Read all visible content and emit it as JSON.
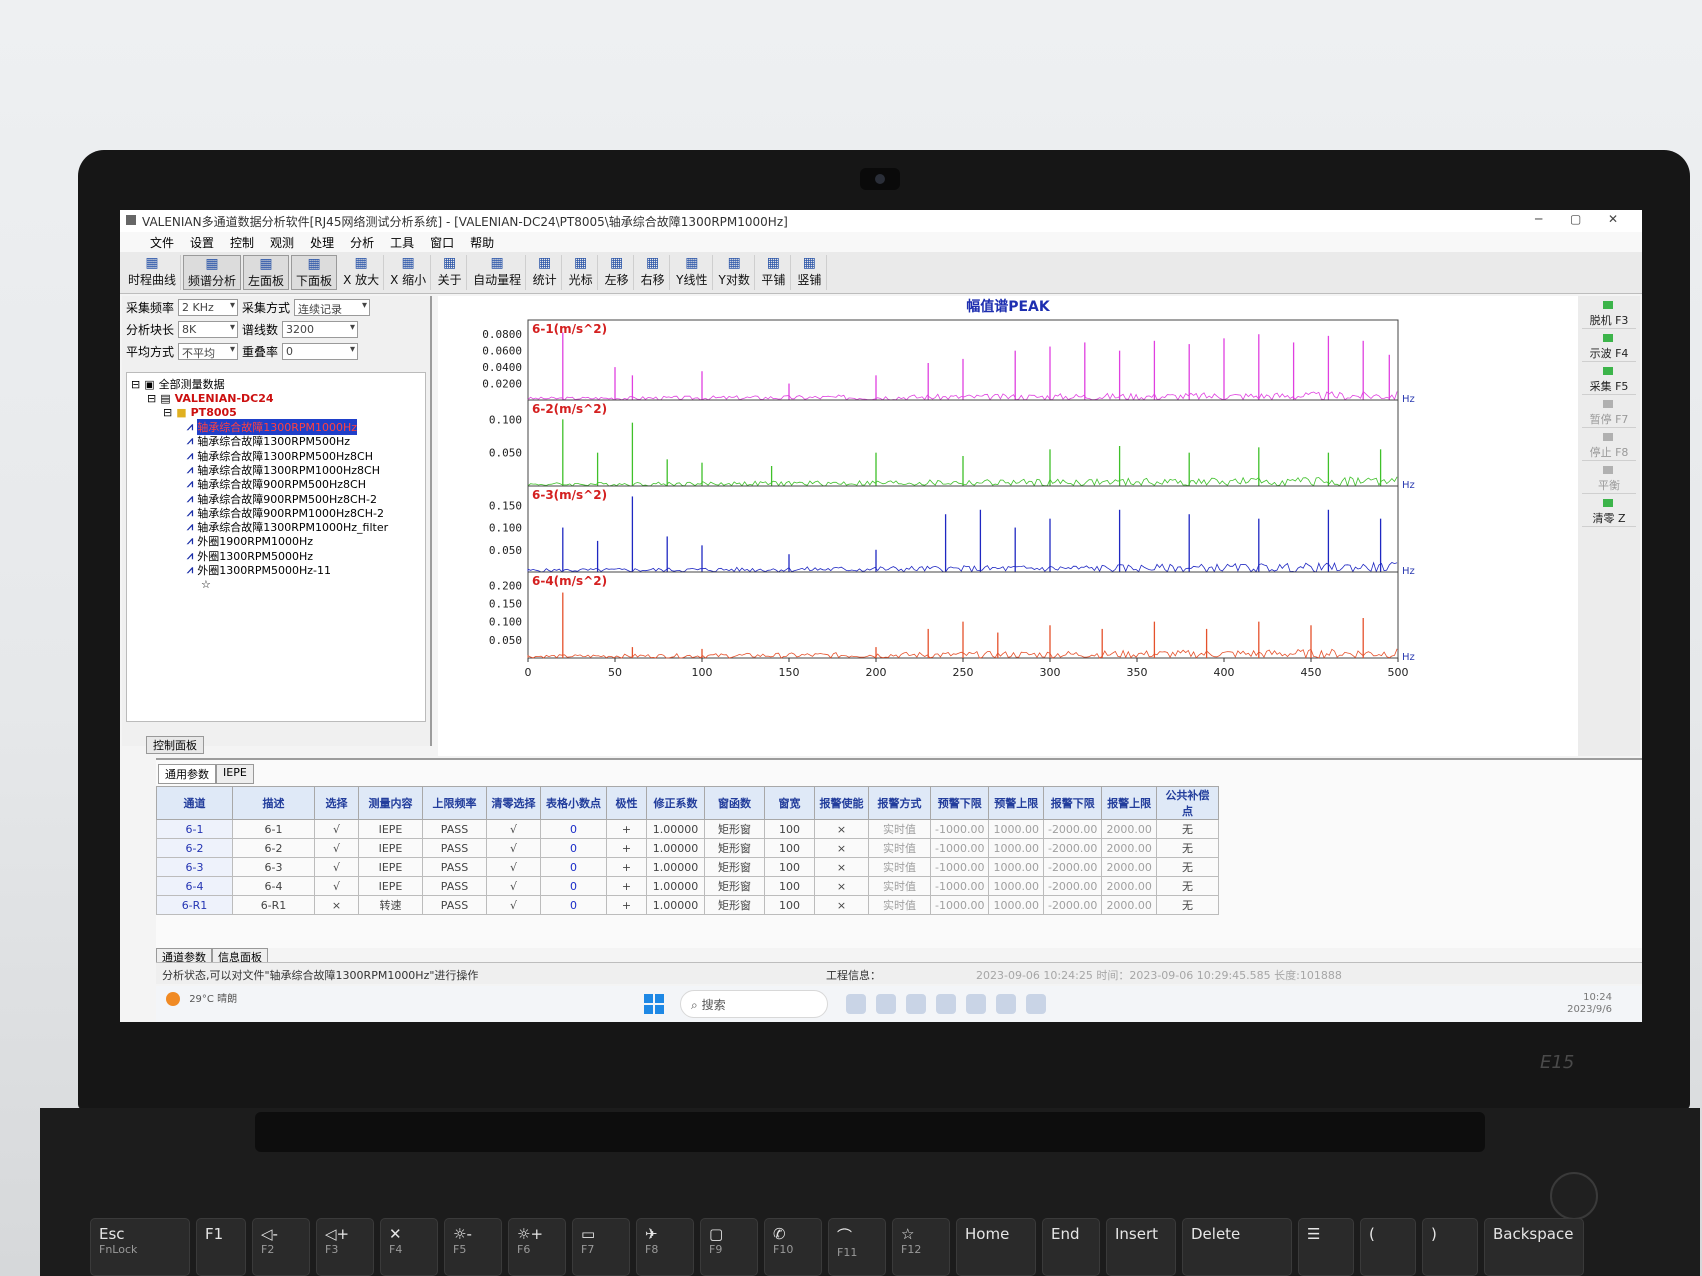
{
  "window": {
    "title": "VALENIAN多通道数据分析软件[RJ45网络测试分析系统] - [VALENIAN-DC24\\PT8005\\轴承综合故障1300RPM1000Hz]"
  },
  "menu": [
    "文件",
    "设置",
    "控制",
    "观测",
    "处理",
    "分析",
    "工具",
    "窗口",
    "帮助"
  ],
  "toolbar": [
    {
      "label": "时程曲线",
      "icon": "time-curve-icon"
    },
    {
      "label": "频谱分析",
      "icon": "spectrum-icon",
      "active": true
    },
    {
      "label": "左面板",
      "icon": "left-panel-icon",
      "active": true
    },
    {
      "label": "下面板",
      "icon": "bottom-panel-icon",
      "active": true
    },
    {
      "label": "X 放大",
      "icon": "zoom-in-x-icon"
    },
    {
      "label": "X 缩小",
      "icon": "zoom-out-x-icon"
    },
    {
      "label": "关于",
      "icon": "help-icon"
    },
    {
      "label": "自动量程",
      "icon": "auto-range-icon"
    },
    {
      "label": "统计",
      "icon": "stats-icon"
    },
    {
      "label": "光标",
      "icon": "cursor-icon"
    },
    {
      "label": "左移",
      "icon": "arrow-left-icon"
    },
    {
      "label": "右移",
      "icon": "arrow-right-icon"
    },
    {
      "label": "Y线性",
      "icon": "y-linear-icon"
    },
    {
      "label": "Y对数",
      "icon": "y-log-icon"
    },
    {
      "label": "平铺",
      "icon": "tile-icon"
    },
    {
      "label": "竖铺",
      "icon": "vertical-tile-icon"
    }
  ],
  "params": {
    "sample_rate_label": "采集频率",
    "sample_rate": "2 KHz",
    "sample_mode_label": "采集方式",
    "sample_mode": "连续记录",
    "block_label": "分析块长",
    "block": "8K",
    "lines_label": "谱线数",
    "lines": "3200",
    "avg_label": "平均方式",
    "avg": "不平均",
    "overlap_label": "重叠率",
    "overlap": "0"
  },
  "tree": {
    "root": "全部测量数据",
    "device": "VALENIAN-DC24",
    "folder": "PT8005",
    "items": [
      "轴承综合故障1300RPM1000Hz",
      "轴承综合故障1300RPM500Hz",
      "轴承综合故障1300RPM500Hz8CH",
      "轴承综合故障1300RPM1000Hz8CH",
      "轴承综合故障900RPM500Hz8CH",
      "轴承综合故障900RPM500Hz8CH-2",
      "轴承综合故障900RPM1000Hz8CH-2",
      "轴承综合故障1300RPM1000Hz_filter",
      "外圈1900RPM1000Hz",
      "外圈1300RPM5000Hz",
      "外圈1300RPM5000Hz-11"
    ],
    "panel_tab": "控制面板"
  },
  "chart_data": {
    "type": "line",
    "title": "幅值谱PEAK",
    "xlabel": "Hz",
    "xlim": [
      0,
      500
    ],
    "x_ticks": [
      0,
      50,
      100,
      150,
      200,
      250,
      300,
      350,
      400,
      450,
      500
    ],
    "series": [
      {
        "name": "6-1(m/s^2)",
        "color": "#e040e0",
        "y_ticks": [
          "0.0800",
          "0.0600",
          "0.0400",
          "0.0200"
        ],
        "ylim": [
          0,
          0.09
        ],
        "peaks": [
          [
            20,
            0.082
          ],
          [
            50,
            0.04
          ],
          [
            60,
            0.03
          ],
          [
            100,
            0.035
          ],
          [
            150,
            0.02
          ],
          [
            200,
            0.03
          ],
          [
            230,
            0.045
          ],
          [
            250,
            0.05
          ],
          [
            280,
            0.06
          ],
          [
            300,
            0.065
          ],
          [
            320,
            0.07
          ],
          [
            340,
            0.06
          ],
          [
            360,
            0.072
          ],
          [
            380,
            0.068
          ],
          [
            400,
            0.075
          ],
          [
            420,
            0.08
          ],
          [
            440,
            0.07
          ],
          [
            460,
            0.078
          ],
          [
            480,
            0.072
          ],
          [
            495,
            0.055
          ]
        ]
      },
      {
        "name": "6-2(m/s^2)",
        "color": "#3fc02a",
        "y_ticks": [
          "0.100",
          "0.050"
        ],
        "ylim": [
          0,
          0.12
        ],
        "peaks": [
          [
            20,
            0.1
          ],
          [
            40,
            0.05
          ],
          [
            60,
            0.095
          ],
          [
            80,
            0.04
          ],
          [
            100,
            0.035
          ],
          [
            140,
            0.03
          ],
          [
            200,
            0.05
          ],
          [
            250,
            0.045
          ],
          [
            300,
            0.055
          ],
          [
            340,
            0.06
          ],
          [
            380,
            0.05
          ],
          [
            420,
            0.058
          ],
          [
            460,
            0.05
          ],
          [
            490,
            0.055
          ]
        ]
      },
      {
        "name": "6-3(m/s^2)",
        "color": "#1f28c2",
        "y_ticks": [
          "0.150",
          "0.100",
          "0.050"
        ],
        "ylim": [
          0,
          0.18
        ],
        "peaks": [
          [
            20,
            0.1
          ],
          [
            40,
            0.07
          ],
          [
            60,
            0.17
          ],
          [
            80,
            0.08
          ],
          [
            100,
            0.06
          ],
          [
            150,
            0.04
          ],
          [
            200,
            0.05
          ],
          [
            240,
            0.13
          ],
          [
            260,
            0.14
          ],
          [
            280,
            0.1
          ],
          [
            300,
            0.12
          ],
          [
            340,
            0.14
          ],
          [
            380,
            0.13
          ],
          [
            420,
            0.12
          ],
          [
            460,
            0.14
          ],
          [
            490,
            0.12
          ]
        ]
      },
      {
        "name": "6-4(m/s^2)",
        "color": "#e5512b",
        "y_ticks": [
          "0.200",
          "0.150",
          "0.100",
          "0.050"
        ],
        "ylim": [
          0,
          0.22
        ],
        "peaks": [
          [
            20,
            0.18
          ],
          [
            60,
            0.03
          ],
          [
            100,
            0.025
          ],
          [
            200,
            0.03
          ],
          [
            230,
            0.08
          ],
          [
            250,
            0.1
          ],
          [
            270,
            0.07
          ],
          [
            300,
            0.09
          ],
          [
            330,
            0.08
          ],
          [
            360,
            0.1
          ],
          [
            390,
            0.08
          ],
          [
            420,
            0.1
          ],
          [
            450,
            0.09
          ],
          [
            480,
            0.11
          ]
        ]
      }
    ]
  },
  "right_buttons": [
    {
      "label": "脱机 F3",
      "enabled": true
    },
    {
      "label": "示波 F4",
      "enabled": true
    },
    {
      "label": "采集 F5",
      "enabled": true
    },
    {
      "label": "暂停 F7",
      "enabled": false
    },
    {
      "label": "停止 F8",
      "enabled": false
    },
    {
      "label": "平衡",
      "enabled": false
    },
    {
      "label": "清零 Z",
      "enabled": true
    }
  ],
  "bottom_tabs": [
    "通用参数",
    "IEPE"
  ],
  "table": {
    "headers": [
      "通道",
      "描述",
      "选择",
      "测量内容",
      "上限频率",
      "清零选择",
      "表格小数点",
      "极性",
      "修正系数",
      "窗函数",
      "窗宽",
      "报警使能",
      "报警方式",
      "预警下限",
      "预警上限",
      "报警下限",
      "报警上限",
      "公共补偿点"
    ],
    "rows": [
      [
        "6-1",
        "6-1",
        "√",
        "IEPE",
        "PASS",
        "√",
        "0",
        "+",
        "1.00000",
        "矩形窗",
        "100",
        "×",
        "实时值",
        "-1000.00",
        "1000.00",
        "-2000.00",
        "2000.00",
        "无"
      ],
      [
        "6-2",
        "6-2",
        "√",
        "IEPE",
        "PASS",
        "√",
        "0",
        "+",
        "1.00000",
        "矩形窗",
        "100",
        "×",
        "实时值",
        "-1000.00",
        "1000.00",
        "-2000.00",
        "2000.00",
        "无"
      ],
      [
        "6-3",
        "6-3",
        "√",
        "IEPE",
        "PASS",
        "√",
        "0",
        "+",
        "1.00000",
        "矩形窗",
        "100",
        "×",
        "实时值",
        "-1000.00",
        "1000.00",
        "-2000.00",
        "2000.00",
        "无"
      ],
      [
        "6-4",
        "6-4",
        "√",
        "IEPE",
        "PASS",
        "√",
        "0",
        "+",
        "1.00000",
        "矩形窗",
        "100",
        "×",
        "实时值",
        "-1000.00",
        "1000.00",
        "-2000.00",
        "2000.00",
        "无"
      ],
      [
        "6-R1",
        "6-R1",
        "×",
        "转速",
        "PASS",
        "√",
        "0",
        "+",
        "1.00000",
        "矩形窗",
        "100",
        "×",
        "实时值",
        "-1000.00",
        "1000.00",
        "-2000.00",
        "2000.00",
        "无"
      ]
    ]
  },
  "lower_tabs": [
    "通道参数",
    "信息面板"
  ],
  "status": {
    "left": "分析状态,可以对文件\"轴承综合故障1300RPM1000Hz\"进行操作",
    "mid": "工程信息：",
    "right": "2023-09-06 10:24:25   时间：2023-09-06 10:29:45.585  长度:101888"
  },
  "taskbar": {
    "weather_temp": "29°C",
    "weather_text": "晴朗",
    "search": "搜索",
    "time": "10:24",
    "date": "2023/9/6"
  },
  "laptop": {
    "model": "E15",
    "keys": [
      {
        "main": "Esc",
        "sub": "FnLock"
      },
      {
        "main": "F1",
        "sub": ""
      },
      {
        "main": "◁-",
        "sub": "F2"
      },
      {
        "main": "◁+",
        "sub": "F3"
      },
      {
        "main": "✕",
        "sub": "F4"
      },
      {
        "main": "☼-",
        "sub": "F5"
      },
      {
        "main": "☼+",
        "sub": "F6"
      },
      {
        "main": "▭",
        "sub": "F7"
      },
      {
        "main": "✈",
        "sub": "F8"
      },
      {
        "main": "▢",
        "sub": "F9"
      },
      {
        "main": "✆",
        "sub": "F10"
      },
      {
        "main": "⌒",
        "sub": "F11"
      },
      {
        "main": "☆",
        "sub": "F12"
      },
      {
        "main": "Home",
        "sub": ""
      },
      {
        "main": "End",
        "sub": ""
      },
      {
        "main": "Insert",
        "sub": ""
      },
      {
        "main": "Delete",
        "sub": ""
      },
      {
        "main": "☰",
        "sub": ""
      },
      {
        "main": "(",
        "sub": ""
      },
      {
        "main": ")",
        "sub": ""
      },
      {
        "main": "Backspace",
        "sub": ""
      }
    ]
  }
}
